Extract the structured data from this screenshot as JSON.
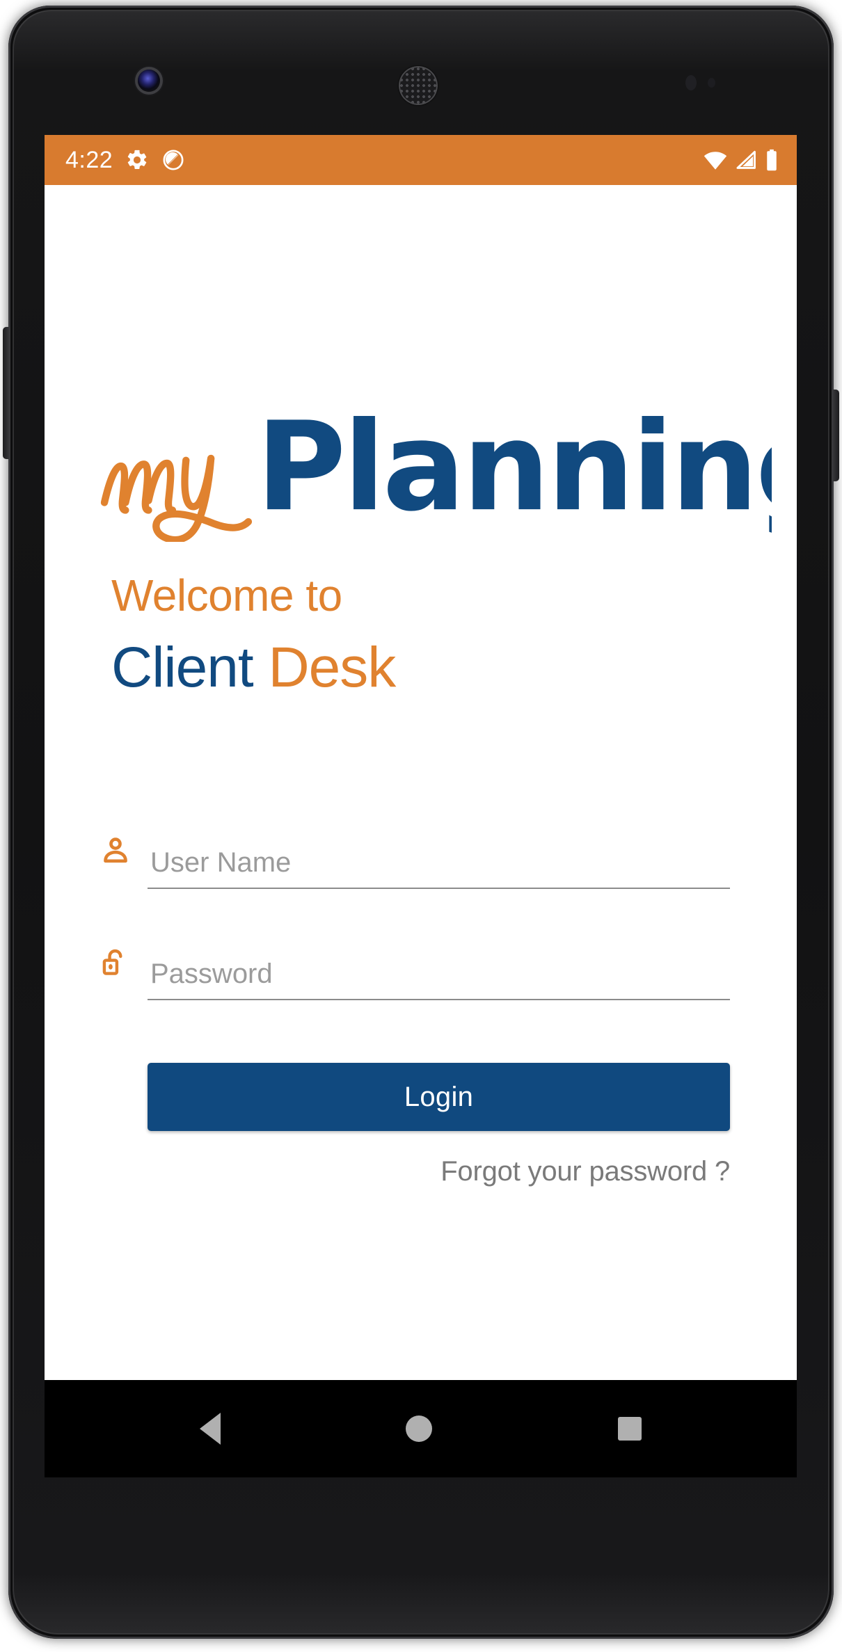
{
  "device": {
    "platform_name": "android-phone"
  },
  "status_bar": {
    "time": "4:22",
    "background_color": "#d87b2f",
    "icons_left": [
      "gear-icon",
      "do-not-disturb-icon"
    ],
    "icons_right": [
      "wifi-icon",
      "cellular-signal-icon",
      "battery-icon"
    ]
  },
  "app": {
    "logo": {
      "prefix_text": "my",
      "main_text": "Planning",
      "prefix_color": "#e0822f",
      "main_color": "#114a80"
    },
    "welcome": {
      "greeting": "Welcome to",
      "product_primary": "Client",
      "product_secondary": " Desk",
      "greeting_color": "#e0822f",
      "primary_color": "#114a80",
      "secondary_color": "#e0822f"
    },
    "form": {
      "username": {
        "placeholder": "User Name",
        "value": "",
        "icon": "person-icon"
      },
      "password": {
        "placeholder": "Password",
        "value": "",
        "icon": "unlocked-padlock-icon"
      },
      "login_label": "Login",
      "login_color": "#10497f",
      "forgot_label": "Forgot your password ?",
      "forgot_color": "#7a7a7a"
    }
  },
  "nav_bar": {
    "back_label": "Back",
    "home_label": "Home",
    "recents_label": "Recent apps",
    "background_color": "#000000"
  }
}
